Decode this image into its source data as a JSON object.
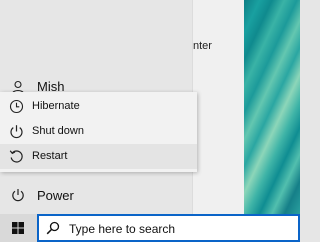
{
  "background_window": {
    "partial_text": "nter"
  },
  "start_menu": {
    "user": {
      "name": "Mish",
      "icon": "user-icon"
    },
    "power_flyout": {
      "items": [
        {
          "label": "Hibernate",
          "icon": "clock-icon",
          "selected": false
        },
        {
          "label": "Shut down",
          "icon": "power-icon",
          "selected": false
        },
        {
          "label": "Restart",
          "icon": "restart-icon",
          "selected": true
        }
      ]
    },
    "power": {
      "label": "Power",
      "icon": "power-icon"
    }
  },
  "taskbar": {
    "start_icon": "windows-logo-icon",
    "search": {
      "placeholder": "Type here to search",
      "icon": "search-icon",
      "accent": "#0a64c8"
    }
  },
  "colors": {
    "wallpaper_accent": "#19a0a0",
    "menu_bg": "#e6e6e6",
    "flyout_bg": "#f2f2f2",
    "selected_bg": "#e4e4e4"
  }
}
